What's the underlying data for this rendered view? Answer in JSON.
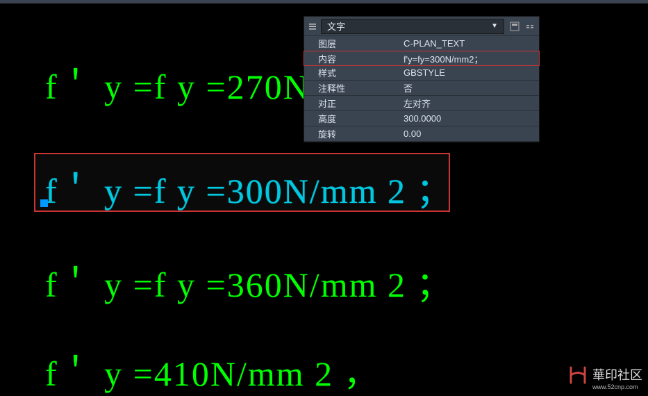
{
  "cad_lines": {
    "line1": "f＇ y =f y =270N",
    "line2": "f＇ y =f y =300N/mm 2 ；",
    "line3": "f＇ y =f y =360N/mm 2 ；",
    "line4": "f＇ y =410N/mm 2 ，"
  },
  "properties": {
    "header": {
      "title": "文字"
    },
    "rows": [
      {
        "label": "图层",
        "value": "C-PLAN_TEXT"
      },
      {
        "label": "内容",
        "value": "f'y=fy=300N/mm2；"
      },
      {
        "label": "样式",
        "value": "GBSTYLE"
      },
      {
        "label": "注释性",
        "value": "否"
      },
      {
        "label": "对正",
        "value": "左对齐"
      },
      {
        "label": "高度",
        "value": "300.0000"
      },
      {
        "label": "旋转",
        "value": "0.00"
      }
    ]
  },
  "watermark": {
    "cn": "華印社区",
    "url": "www.52cnp.com"
  }
}
